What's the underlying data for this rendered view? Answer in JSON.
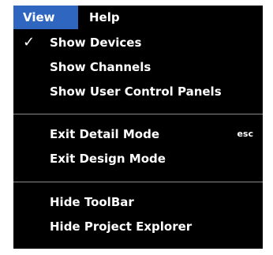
{
  "menubar": {
    "items": [
      {
        "label": "View",
        "active": true
      },
      {
        "label": "Help",
        "active": false
      }
    ],
    "active_color": "#2f66c0"
  },
  "view_menu": {
    "groups": [
      {
        "items": [
          {
            "label": "Show Devices",
            "checked": true,
            "check_glyph": "✓"
          },
          {
            "label": "Show Channels",
            "checked": false
          },
          {
            "label": "Show User Control Panels",
            "checked": false
          }
        ]
      },
      {
        "items": [
          {
            "label": "Exit Detail Mode",
            "shortcut": "esc"
          },
          {
            "label": "Exit Design Mode"
          }
        ]
      },
      {
        "items": [
          {
            "label": "Hide ToolBar"
          },
          {
            "label": "Hide Project Explorer"
          }
        ]
      }
    ]
  }
}
